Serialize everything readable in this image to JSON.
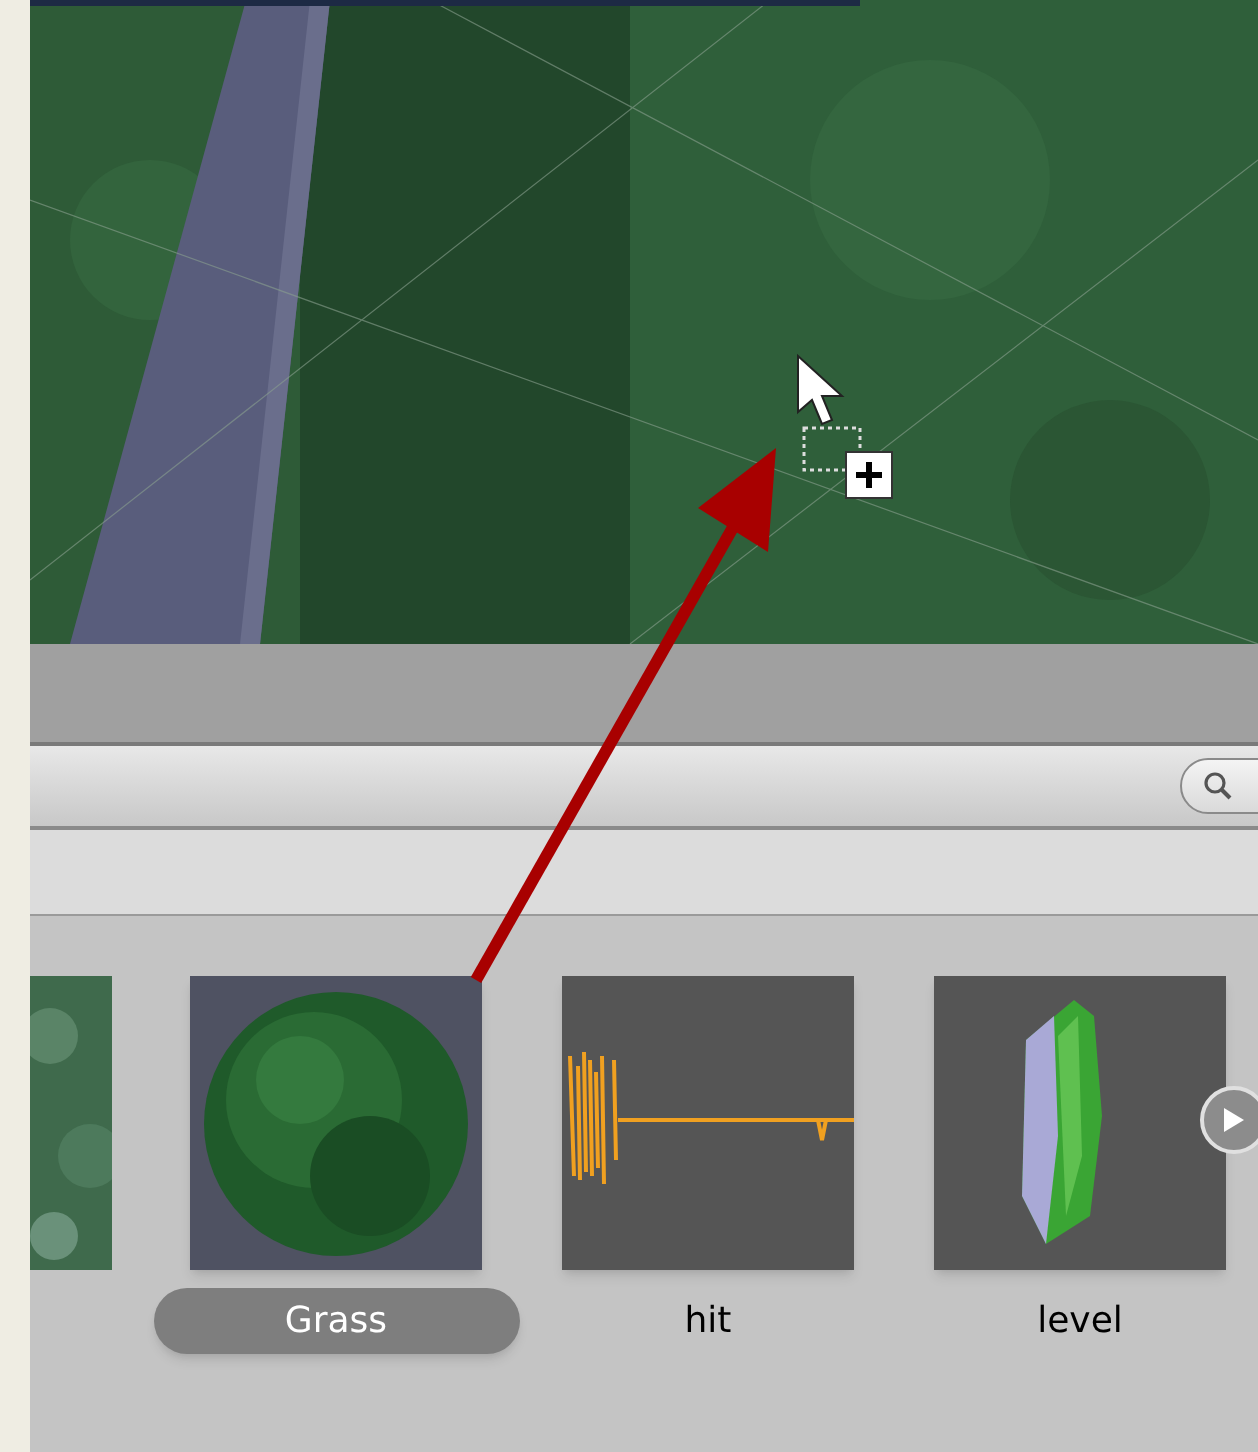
{
  "assets": [
    {
      "name": "Grass",
      "kind": "material",
      "selected": true
    },
    {
      "name": "hit",
      "kind": "audio",
      "selected": false
    },
    {
      "name": "level",
      "kind": "model",
      "selected": false
    }
  ]
}
